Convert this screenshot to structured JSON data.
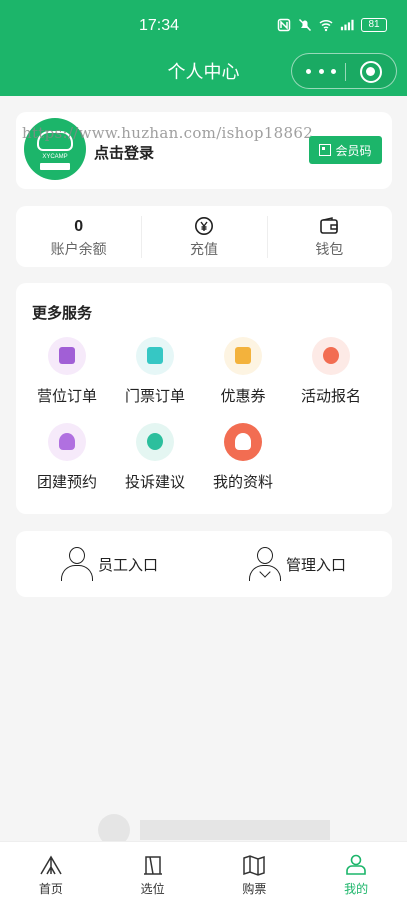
{
  "status_bar": {
    "time": "17:34",
    "battery": "81"
  },
  "header": {
    "title": "个人中心",
    "accent_color": "#1cb56a"
  },
  "profile": {
    "avatar_text": "XYCAMP",
    "login_label": "点击登录",
    "watermark": "https://www.huzhan.com/ishop18862",
    "member_code_label": "会员码"
  },
  "wallet": {
    "balance_value": "0",
    "balance_label": "账户余额",
    "recharge_label": "充值",
    "wallet_label": "钱包"
  },
  "services": {
    "title": "更多服务",
    "items": [
      {
        "label": "营位订单",
        "icon": "list-icon",
        "bg": "#f6eafa",
        "color": "#a15fd6"
      },
      {
        "label": "门票订单",
        "icon": "ticket-icon",
        "bg": "#e6f7f7",
        "color": "#36c7c4"
      },
      {
        "label": "优惠券",
        "icon": "coupon-icon",
        "bg": "#fdf4e2",
        "color": "#f3b23c"
      },
      {
        "label": "活动报名",
        "icon": "flame-icon",
        "bg": "#fdeae6",
        "color": "#f26d52"
      },
      {
        "label": "团建预约",
        "icon": "group-icon",
        "bg": "#f6eafa",
        "color": "#b070e0"
      },
      {
        "label": "投诉建议",
        "icon": "phone-icon",
        "bg": "#e4f6f2",
        "color": "#2cbf9d"
      },
      {
        "label": "我的资料",
        "icon": "profile-icon",
        "bg": "#f26d52",
        "color": "#ffffff"
      }
    ]
  },
  "entries": {
    "staff_label": "员工入口",
    "admin_label": "管理入口"
  },
  "tabbar": {
    "items": [
      {
        "label": "首页",
        "icon": "home-tent-icon"
      },
      {
        "label": "选位",
        "icon": "select-icon"
      },
      {
        "label": "购票",
        "icon": "ticket-map-icon"
      },
      {
        "label": "我的",
        "icon": "user-icon"
      }
    ]
  }
}
